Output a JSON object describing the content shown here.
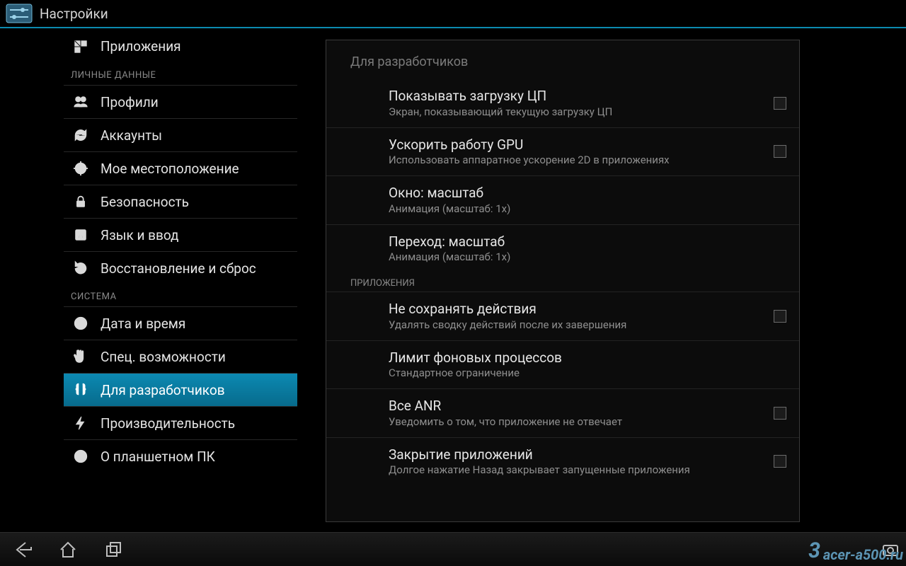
{
  "header": {
    "title": "Настройки"
  },
  "nav": {
    "items": [
      {
        "label": "Приложения",
        "icon": "apps"
      },
      {
        "header": "ЛИЧНЫЕ ДАННЫЕ"
      },
      {
        "label": "Профили",
        "icon": "profiles"
      },
      {
        "label": "Аккаунты",
        "icon": "sync"
      },
      {
        "label": "Мое местоположение",
        "icon": "location"
      },
      {
        "label": "Безопасность",
        "icon": "lock"
      },
      {
        "label": "Язык и ввод",
        "icon": "language"
      },
      {
        "label": "Восстановление и сброс",
        "icon": "reset"
      },
      {
        "header": "СИСТЕМА"
      },
      {
        "label": "Дата и время",
        "icon": "clock"
      },
      {
        "label": "Спец. возможности",
        "icon": "hand"
      },
      {
        "label": "Для разработчиков",
        "icon": "braces",
        "selected": true
      },
      {
        "label": "Производительность",
        "icon": "bolt"
      },
      {
        "label": "О планшетном ПК",
        "icon": "info"
      }
    ]
  },
  "panel": {
    "title": "Для разработчиков",
    "rows": [
      {
        "title": "Показывать загрузку ЦП",
        "sub": "Экран, показывающий текущую загрузку ЦП",
        "checkbox": true,
        "checked": false
      },
      {
        "title": "Ускорить работу GPU",
        "sub": "Использовать аппаратное ускорение 2D в приложениях",
        "checkbox": true,
        "checked": false
      },
      {
        "title": "Окно: масштаб",
        "sub": "Анимация (масштаб: 1х)"
      },
      {
        "title": "Переход: масштаб",
        "sub": "Анимация (масштаб: 1х)"
      },
      {
        "section": "ПРИЛОЖЕНИЯ"
      },
      {
        "title": "Не сохранять действия",
        "sub": "Удалять сводку действий после их завершения",
        "checkbox": true,
        "checked": false
      },
      {
        "title": "Лимит фоновых процессов",
        "sub": "Стандартное ограничение"
      },
      {
        "title": "Все ANR",
        "sub": "Уведомить о том, что приложение не отвечает",
        "checkbox": true,
        "checked": false
      },
      {
        "title": "Закрытие приложений",
        "sub": "Долгое нажатие Назад закрывает запущенные приложения",
        "checkbox": true,
        "checked": false
      }
    ]
  },
  "watermark": {
    "digit": "3",
    "text": "acer-a500.ru"
  }
}
